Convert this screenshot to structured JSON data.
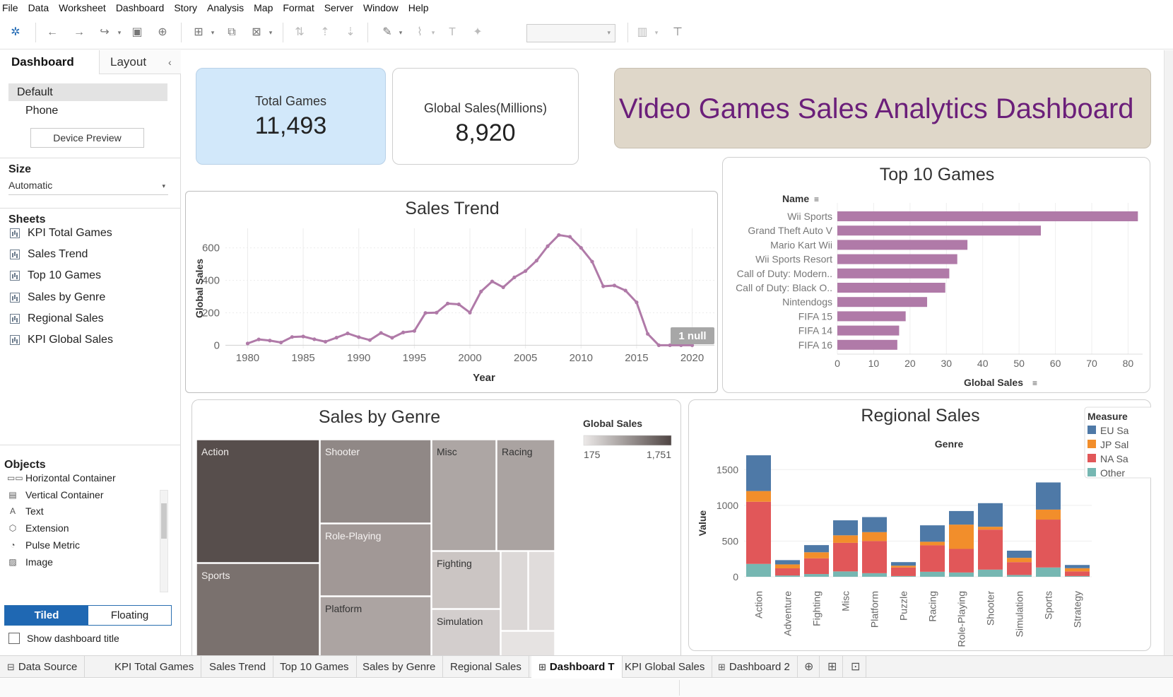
{
  "menu": [
    "File",
    "Data",
    "Worksheet",
    "Dashboard",
    "Story",
    "Analysis",
    "Map",
    "Format",
    "Server",
    "Window",
    "Help"
  ],
  "sidebar": {
    "tab_dashboard": "Dashboard",
    "tab_layout": "Layout",
    "collapse_glyph": "‹",
    "devices": [
      "Default",
      "Phone"
    ],
    "device_preview": "Device Preview",
    "size_title": "Size",
    "size_value": "Automatic",
    "sheets_title": "Sheets",
    "sheets": [
      "KPI Total Games",
      "Sales Trend",
      "Top 10 Games",
      "Sales by Genre",
      "Regional Sales",
      "KPI Global Sales"
    ],
    "objects_title": "Objects",
    "objects": [
      {
        "label": "Horizontal Container",
        "icon": "horizontal-container-icon",
        "glyph": "▭▭"
      },
      {
        "label": "Vertical Container",
        "icon": "vertical-container-icon",
        "glyph": "▤"
      },
      {
        "label": "Text",
        "icon": "text-icon",
        "glyph": "A"
      },
      {
        "label": "Extension",
        "icon": "extension-icon",
        "glyph": "⬡"
      },
      {
        "label": "Pulse Metric",
        "icon": "pulse-metric-icon",
        "glyph": "◔"
      },
      {
        "label": "Image",
        "icon": "image-icon",
        "glyph": "▨"
      }
    ],
    "tiled": "Tiled",
    "floating": "Floating",
    "show_title": "Show dashboard title"
  },
  "kpi": {
    "total_games_label": "Total Games",
    "total_games_value": "11,493",
    "global_sales_label": "Global Sales(Millions)",
    "global_sales_value": "8,920"
  },
  "dashboard_title": "Video Games Sales Analytics Dashboard",
  "sales_trend": {
    "title": "Sales Trend",
    "ylabel": "Global Sales",
    "xlabel": "Year",
    "null_badge": "1 null",
    "chart_data": {
      "type": "line",
      "x": [
        1980,
        1981,
        1982,
        1983,
        1984,
        1985,
        1986,
        1987,
        1988,
        1989,
        1990,
        1991,
        1992,
        1993,
        1994,
        1995,
        1996,
        1997,
        1998,
        1999,
        2000,
        2001,
        2002,
        2003,
        2004,
        2005,
        2006,
        2007,
        2008,
        2009,
        2010,
        2011,
        2012,
        2013,
        2014,
        2015,
        2016,
        2017,
        2018,
        2019,
        2020
      ],
      "y": [
        11,
        36,
        29,
        17,
        51,
        54,
        37,
        22,
        47,
        73,
        50,
        32,
        76,
        46,
        79,
        88,
        199,
        201,
        257,
        252,
        201,
        331,
        393,
        357,
        418,
        457,
        521,
        610,
        679,
        668,
        600,
        515,
        363,
        368,
        337,
        264,
        70,
        0,
        0,
        0,
        0
      ],
      "xticks": [
        1980,
        1985,
        1990,
        1995,
        2000,
        2005,
        2010,
        2015,
        2020
      ],
      "yticks": [
        0,
        200,
        400,
        600
      ],
      "xlim": [
        1978,
        2022
      ],
      "ylim": [
        -20,
        720
      ],
      "color": "#b07aa8"
    }
  },
  "top10": {
    "title": "Top 10 Games",
    "name_header": "Name",
    "xlabel": "Global Sales",
    "chart_data": {
      "type": "bar",
      "orientation": "horizontal",
      "categories": [
        "Wii Sports",
        "Grand Theft Auto V",
        "Mario Kart Wii",
        "Wii Sports Resort",
        "Call of Duty: Modern..",
        "Call of Duty: Black O..",
        "Nintendogs",
        "FIFA 15",
        "FIFA 14",
        "FIFA 16"
      ],
      "values": [
        82.7,
        56.0,
        35.8,
        33.0,
        30.8,
        29.7,
        24.7,
        18.8,
        17.0,
        16.5
      ],
      "xticks": [
        0,
        10,
        20,
        30,
        40,
        50,
        60,
        70,
        80
      ],
      "xlim": [
        0,
        84
      ],
      "color": "#b07aa8"
    }
  },
  "genre": {
    "title": "Sales by Genre",
    "legend_title": "Global Sales",
    "legend_min": "175",
    "legend_max": "1,751",
    "chart_data": {
      "type": "heatmap",
      "subtype": "treemap",
      "labels": [
        "Action",
        "Sports",
        "Shooter",
        "Role-Playing",
        "Platform",
        "Misc",
        "Racing",
        "Fighting",
        "Simulation"
      ],
      "color_range": [
        175,
        1751
      ]
    }
  },
  "regional": {
    "title": "Regional Sales",
    "column_header": "Genre",
    "ylabel": "Value",
    "legend_title": "Measure",
    "legend": [
      {
        "label": "EU Sa",
        "color": "#4e79a7"
      },
      {
        "label": "JP Sal",
        "color": "#f28e2b"
      },
      {
        "label": "NA Sa",
        "color": "#e15759"
      },
      {
        "label": "Other",
        "color": "#76b7b2"
      }
    ],
    "chart_data": {
      "type": "bar",
      "stacked": true,
      "categories": [
        "Action",
        "Adventure",
        "Fighting",
        "Misc",
        "Platform",
        "Puzzle",
        "Racing",
        "Role-Playing",
        "Shooter",
        "Simulation",
        "Sports",
        "Strategy"
      ],
      "series": [
        {
          "name": "Other",
          "values": [
            180,
            18,
            38,
            75,
            50,
            10,
            70,
            60,
            100,
            25,
            130,
            10
          ]
        },
        {
          "name": "NA Sales",
          "values": [
            870,
            100,
            220,
            400,
            450,
            120,
            370,
            330,
            560,
            180,
            670,
            65
          ]
        },
        {
          "name": "JP Sales",
          "values": [
            150,
            55,
            85,
            105,
            125,
            25,
            50,
            340,
            40,
            60,
            140,
            45
          ]
        },
        {
          "name": "EU Sales",
          "values": [
            500,
            60,
            100,
            210,
            210,
            50,
            230,
            190,
            330,
            100,
            380,
            45
          ]
        }
      ],
      "yticks": [
        0,
        500,
        1000,
        1500
      ],
      "ylim": [
        -80,
        1760
      ]
    }
  },
  "bottom_tabs": [
    {
      "label": "Data Source",
      "icon": "data-source-icon",
      "glyph": "⊟"
    },
    {
      "label": "KPI Total Games",
      "icon": "",
      "glyph": ""
    },
    {
      "label": "Sales Trend",
      "icon": "",
      "glyph": ""
    },
    {
      "label": "Top 10 Games",
      "icon": "",
      "glyph": ""
    },
    {
      "label": "Sales by Genre",
      "icon": "",
      "glyph": ""
    },
    {
      "label": "Regional Sales",
      "icon": "",
      "glyph": ""
    },
    {
      "label": "Dashboard T",
      "icon": "dashboard-icon",
      "glyph": "⊞"
    },
    {
      "label": "KPI Global Sales",
      "icon": "",
      "glyph": ""
    },
    {
      "label": "Dashboard 2",
      "icon": "dashboard-icon",
      "glyph": "⊞"
    }
  ],
  "new_sheet_glyphs": [
    "⊕",
    "⊞",
    "⊡"
  ]
}
